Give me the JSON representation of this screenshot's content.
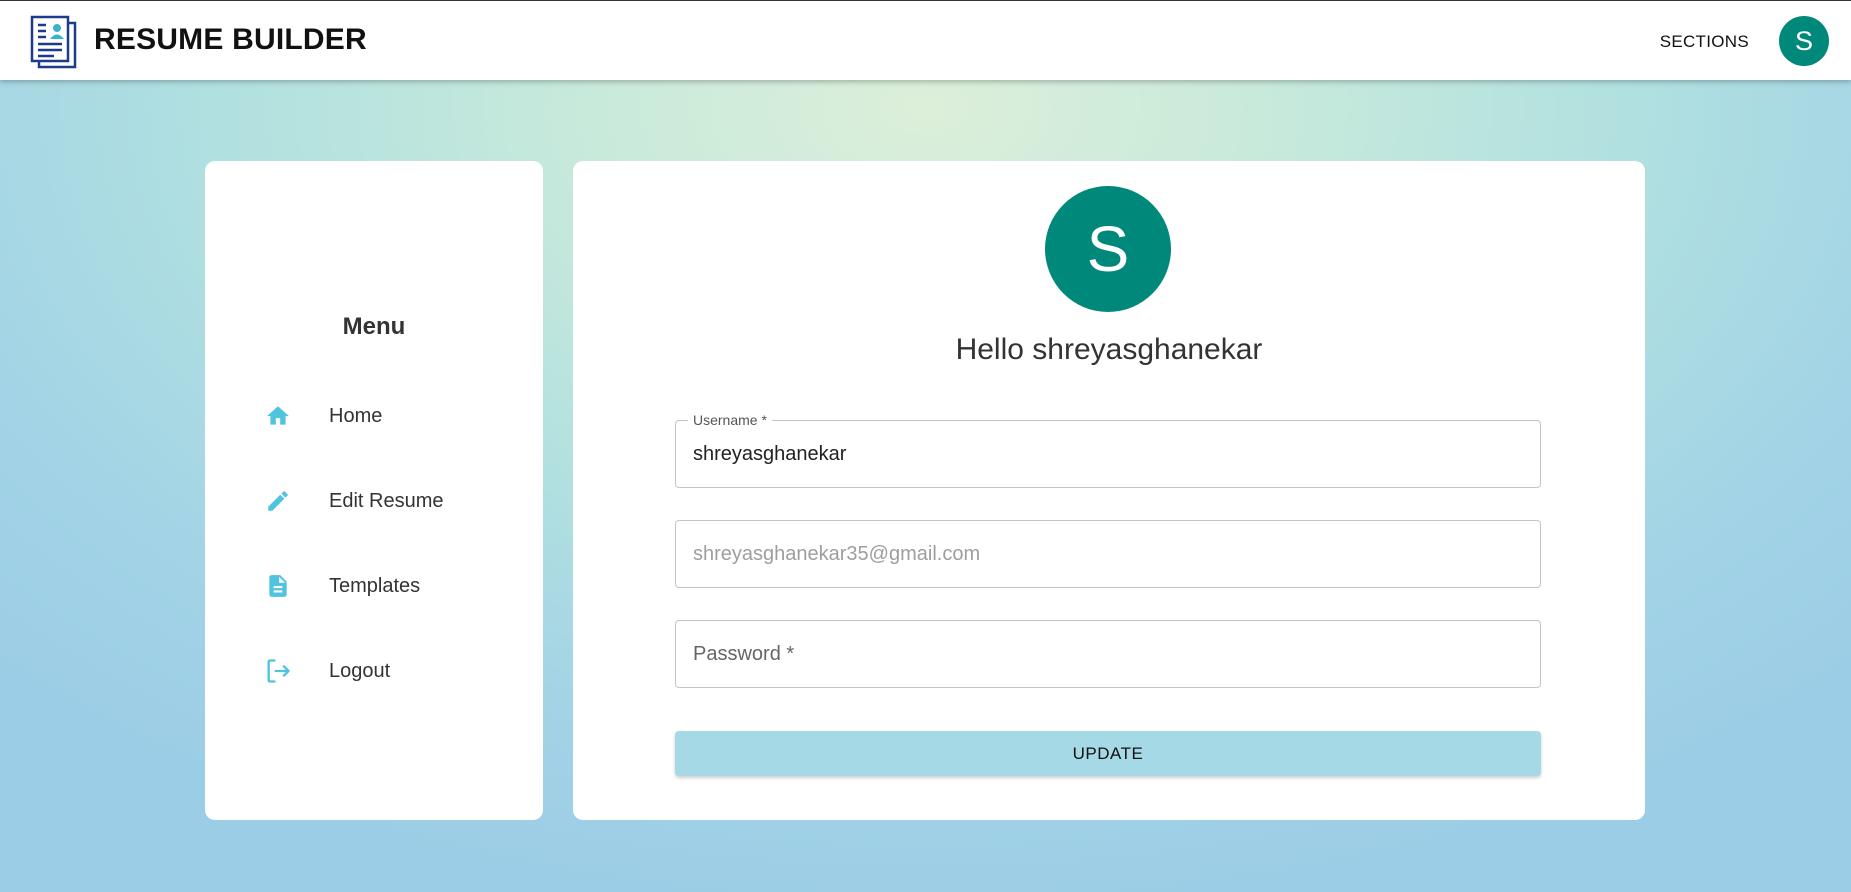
{
  "header": {
    "app_title": "RESUME BUILDER",
    "sections_label": "SECTIONS",
    "avatar_initial": "S"
  },
  "menu": {
    "title": "Menu",
    "items": [
      {
        "label": "Home",
        "icon": "home-icon"
      },
      {
        "label": "Edit Resume",
        "icon": "pencil-icon"
      },
      {
        "label": "Templates",
        "icon": "document-icon"
      },
      {
        "label": "Logout",
        "icon": "logout-icon"
      }
    ],
    "icon_color": "#4fc3e0"
  },
  "profile": {
    "avatar_initial": "S",
    "greeting": "Hello shreyasghanekar",
    "username": {
      "label": "Username *",
      "value": "shreyasghanekar"
    },
    "email": {
      "value": "shreyasghanekar35@gmail.com"
    },
    "password": {
      "placeholder": "Password *"
    },
    "update_label": "UPDATE"
  },
  "colors": {
    "accent_teal": "#00897b",
    "button_bg": "#a5d9e6"
  }
}
